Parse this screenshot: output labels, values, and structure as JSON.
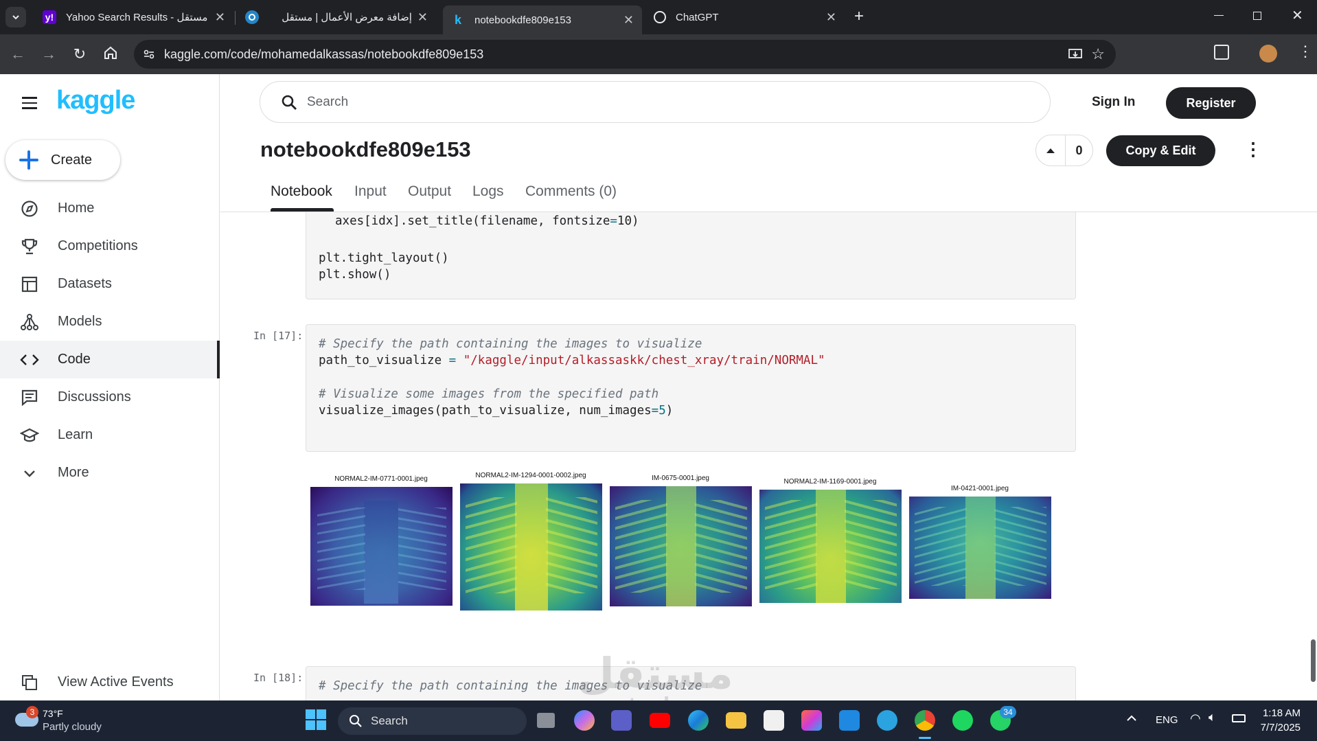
{
  "browser": {
    "tabs": [
      {
        "title": "Yahoo Search Results - مستقل",
        "favicon": "yahoo-icon"
      },
      {
        "title": "إضافة معرض الأعمال | مستقل",
        "favicon": "mostaql-icon"
      },
      {
        "title": "notebookdfe809e153",
        "favicon": "kaggle-icon"
      },
      {
        "title": "ChatGPT",
        "favicon": "chatgpt-icon"
      }
    ],
    "url": "kaggle.com/code/mohamedalkassas/notebookdfe809e153"
  },
  "kaggle": {
    "logo": "kaggle",
    "create_label": "Create",
    "nav": [
      {
        "label": "Home",
        "icon": "compass-icon"
      },
      {
        "label": "Competitions",
        "icon": "trophy-icon"
      },
      {
        "label": "Datasets",
        "icon": "table-icon"
      },
      {
        "label": "Models",
        "icon": "models-icon"
      },
      {
        "label": "Code",
        "icon": "code-icon"
      },
      {
        "label": "Discussions",
        "icon": "discussion-icon"
      },
      {
        "label": "Learn",
        "icon": "learn-icon"
      },
      {
        "label": "More",
        "icon": "chevron-down-icon"
      }
    ],
    "view_active_events": "View Active Events",
    "search_placeholder": "Search",
    "sign_in": "Sign In",
    "register": "Register",
    "notebook_title": "notebookdfe809e153",
    "vote_count": "0",
    "copy_edit": "Copy & Edit",
    "tabs": [
      "Notebook",
      "Input",
      "Output",
      "Logs",
      "Comments (0)"
    ],
    "active_tab": "Notebook"
  },
  "cells": {
    "prev_lines": [
      "    axes[idx].set_title(filename, fontsize=10)",
      "plt.tight_layout()",
      "plt.show()"
    ],
    "cell17": {
      "prompt": "In [17]:",
      "line1": "# Specify the path containing the images to visualize",
      "line2_var": "path_to_visualize",
      "line2_op": " = ",
      "line2_str": "\"/kaggle/input/alkassaskk/chest_xray/train/NORMAL\"",
      "line3": "# Visualize some images from the specified path",
      "line4_a": "visualize_images(path_to_visualize, num_images",
      "line4_b": "=5",
      "line4_c": ")"
    },
    "images": [
      "NORMAL2-IM-0771-0001.jpeg",
      "NORMAL2-IM-1294-0001-0002.jpeg",
      "IM-0675-0001.jpeg",
      "NORMAL2-IM-1169-0001.jpeg",
      "IM-0421-0001.jpeg"
    ],
    "cell18": {
      "prompt": "In [18]:",
      "line1": "# Specify the path containing the images to visualize"
    }
  },
  "watermark": {
    "arabic": "مستقل",
    "latin": "mostaql.com"
  },
  "taskbar": {
    "weather_temp": "73°F",
    "weather_desc": "Partly cloudy",
    "weather_badge": "3",
    "search": "Search",
    "lang": "ENG",
    "time": "1:18 AM",
    "date": "7/7/2025",
    "whatsapp_badge": "34"
  },
  "colors": {
    "kaggle_blue": "#20beff",
    "chrome_dark": "#202124",
    "taskbar": "#1c2434"
  }
}
